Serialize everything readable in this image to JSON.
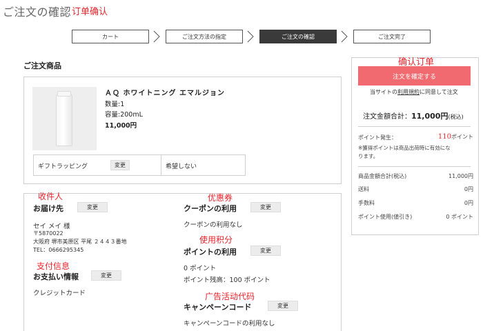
{
  "header": {
    "title": "ご注文の確認",
    "title_annotation": "订单确认"
  },
  "steps": [
    {
      "label": "カート",
      "active": false
    },
    {
      "label": "ご注文方法の指定",
      "active": false
    },
    {
      "label": "ご注文の確認",
      "active": true
    },
    {
      "label": "ご注文完了",
      "active": false
    }
  ],
  "products": {
    "heading": "ご注文商品",
    "item": {
      "name": "ＡＱ ホワイトニング エマルジョン",
      "quantity": "数量:1",
      "volume": "容量:200mL",
      "price": "11,000円"
    },
    "gift": {
      "label": "ギフトラッピング",
      "change_label": "変更",
      "value": "希望しない"
    }
  },
  "shipping": {
    "annotation": "收件人",
    "heading": "お届け先",
    "change_label": "変更",
    "name": "セイ メイ 様",
    "postal": "〒5870022",
    "address": "大阪府 堺市美原区 平尾 ２４４３番地",
    "tel": "TEL：0666295345"
  },
  "payment": {
    "annotation": "支付信息",
    "heading": "お支払い情報",
    "change_label": "変更",
    "method": "クレジットカード"
  },
  "coupon": {
    "annotation": "优惠券",
    "heading": "クーポンの利用",
    "change_label": "変更",
    "value": "クーポンの利用なし"
  },
  "points": {
    "annotation": "使用积分",
    "heading": "ポイントの利用",
    "change_label": "変更",
    "used": "0 ポイント",
    "balance": "ポイント残高：100 ポイント"
  },
  "campaign": {
    "annotation": "广告活动代码",
    "heading": "キャンペーンコード",
    "change_label": "変更",
    "value": "キャンペーンコードの利用なし"
  },
  "summary": {
    "annotation": "确认订单",
    "confirm_label": "注文を確定する",
    "terms_prefix": "当サイトの",
    "terms_link": "利用規約",
    "terms_suffix": "に同意して注文",
    "total_label": "注文金額合計：",
    "total_value": "11,000円",
    "total_suffix": "(税込)",
    "points_label": "ポイント発生：",
    "points_num": "110",
    "points_unit": "ポイント",
    "points_note_1": "※獲得ポイントは商品出荷時に有効にな",
    "points_note_2": "ります。",
    "rows": [
      {
        "label": "商品金額合計(税込)",
        "value": "11,000円"
      },
      {
        "label": "送料",
        "value": "0円"
      },
      {
        "label": "手数料",
        "value": "0円"
      },
      {
        "label": "ポイント使用(値引き)",
        "value": "0 ポイント"
      }
    ]
  },
  "colors": {
    "accent": "#f06a6f",
    "annotation": "#e8242b",
    "active_step": "#3a3a3a"
  }
}
